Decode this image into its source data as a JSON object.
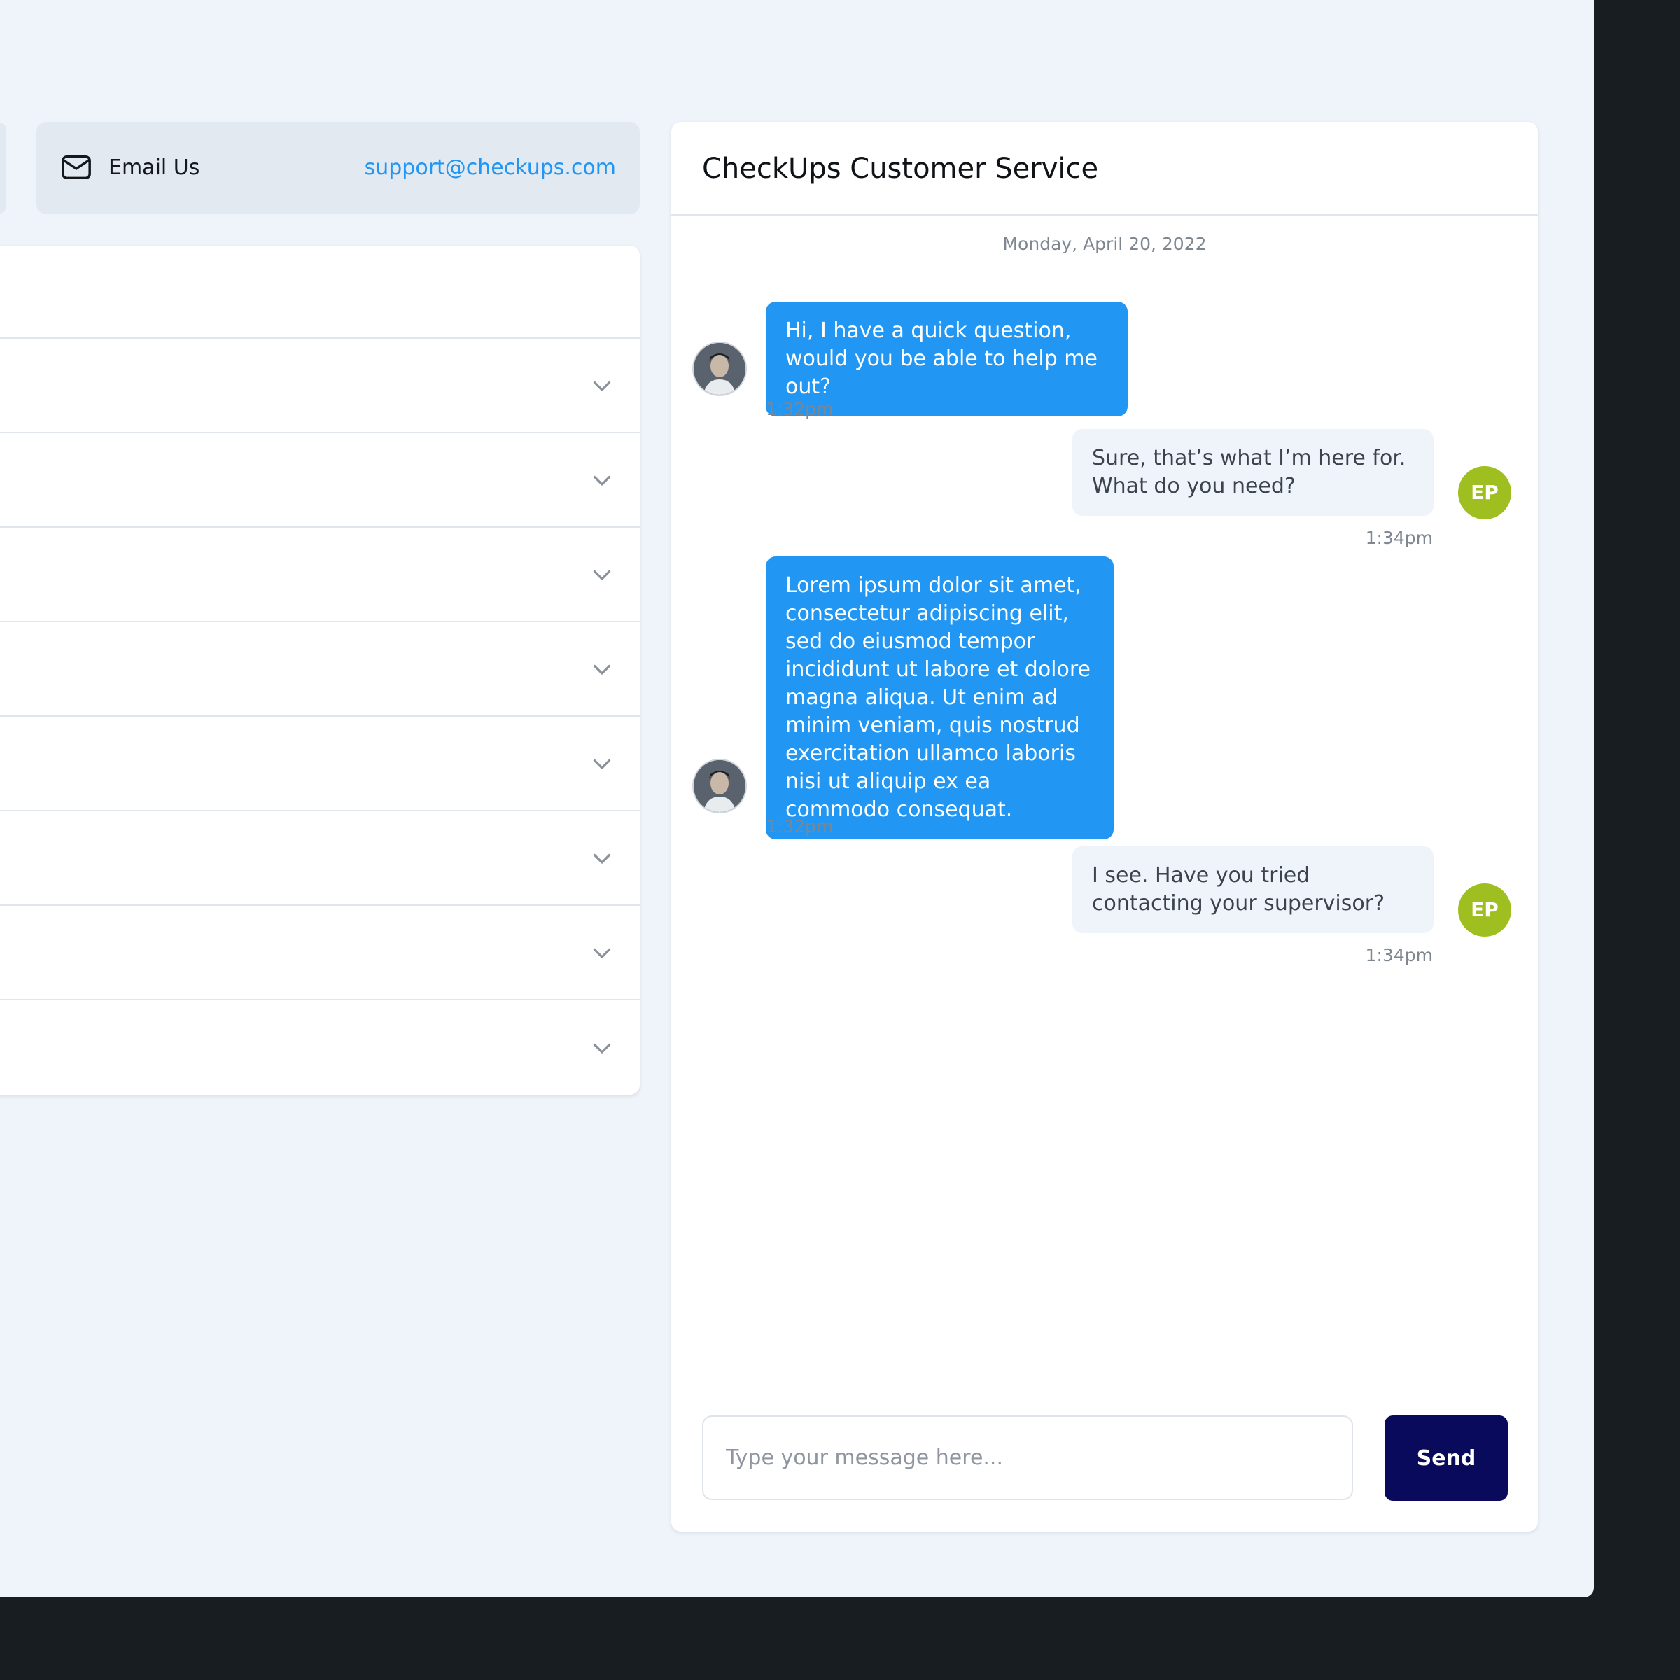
{
  "contact": {
    "email_label": "Email Us",
    "email_address": "support@checkups.com",
    "icon": "mail-icon"
  },
  "faq": {
    "item_count": 8,
    "icon": "chevron-down-icon"
  },
  "chat": {
    "title": "CheckUps Customer Service",
    "date": "Monday, April 20, 2022",
    "messages": [
      {
        "from": "customer",
        "text": "Hi, I have a quick question, would you be able to help me out?",
        "time": "1:32pm"
      },
      {
        "from": "agent",
        "initials": "EP",
        "text": "Sure, that’s what I’m here for. What do you need?",
        "time": "1:34pm"
      },
      {
        "from": "customer",
        "text": "Lorem ipsum dolor sit amet, consectetur adipiscing elit, sed do eiusmod tempor incididunt ut labore et dolore magna aliqua. Ut enim ad minim veniam, quis nostrud exercitation ullamco laboris nisi ut aliquip ex ea commodo consequat.",
        "time": "1:32pm"
      },
      {
        "from": "agent",
        "initials": "EP",
        "text": "I see. Have you tried contacting your supervisor?",
        "time": "1:34pm"
      }
    ],
    "input_placeholder": "Type your message here...",
    "send_label": "Send"
  },
  "colors": {
    "accent": "#2196f3",
    "agent_avatar": "#9fbe1f",
    "send_button": "#0a0a5c",
    "page_background": "#eff4fb"
  }
}
